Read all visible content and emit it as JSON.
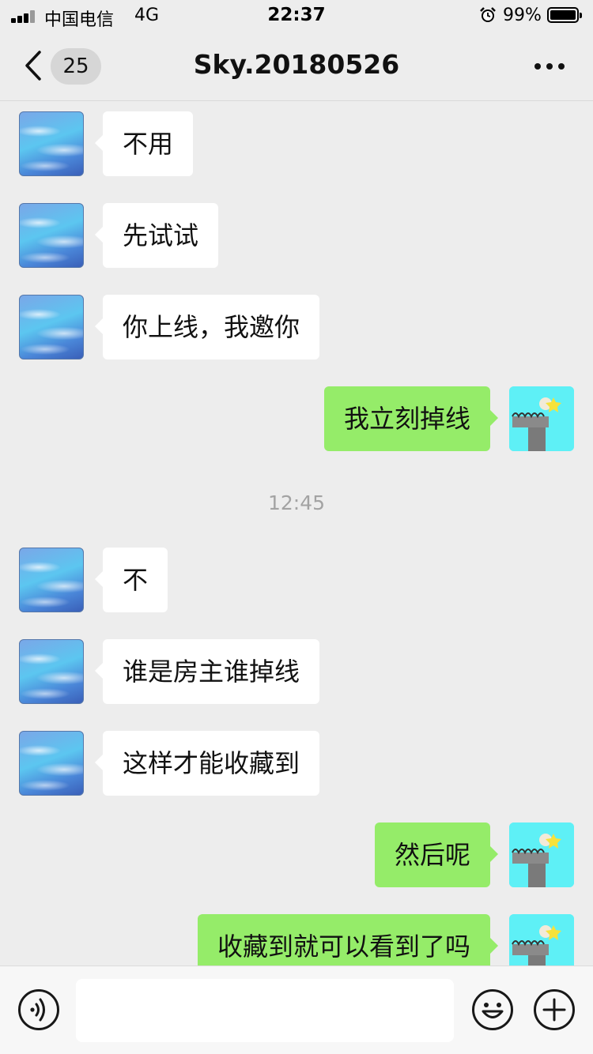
{
  "status_bar": {
    "carrier": "中国电信",
    "network": "4G",
    "time": "22:37",
    "battery_percent": "99%"
  },
  "nav": {
    "unread_count": "25",
    "title": "Sky.20180526"
  },
  "messages": [
    {
      "side": "in",
      "text": "不用"
    },
    {
      "side": "in",
      "text": "先试试"
    },
    {
      "side": "in",
      "text": "你上线，我邀你"
    },
    {
      "side": "out",
      "text": "我立刻掉线"
    },
    {
      "side": "in",
      "text": "不"
    },
    {
      "side": "in",
      "text": "谁是房主谁掉线"
    },
    {
      "side": "in",
      "text": "这样才能收藏到"
    },
    {
      "side": "out",
      "text": "然后呢"
    },
    {
      "side": "out",
      "text": "收藏到就可以看到了吗"
    }
  ],
  "time_divider": "12:45",
  "input": {
    "value": "",
    "placeholder": ""
  },
  "icons": {
    "back": "chevron-left-icon",
    "more": "more-dots-icon",
    "voice": "voice-icon",
    "emoji": "emoji-icon",
    "plus": "plus-icon"
  },
  "colors": {
    "background": "#ededed",
    "incoming_bubble": "#ffffff",
    "outgoing_bubble": "#95ec69",
    "time_text": "#a3a3a3"
  }
}
